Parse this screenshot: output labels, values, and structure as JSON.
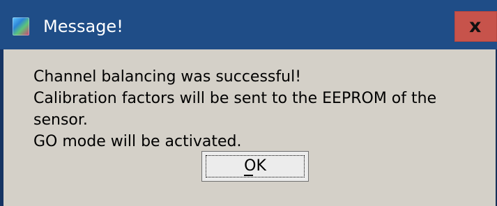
{
  "window": {
    "title": "Message!",
    "close_label": "x"
  },
  "message": {
    "lines": [
      "Channel balancing was successful!",
      "Calibration factors will be sent to the EEPROM of the sensor.",
      "GO mode will be activated."
    ]
  },
  "buttons": {
    "ok_label": "OK"
  },
  "icons": {
    "app_icon": "app-icon",
    "close_icon": "close-icon"
  },
  "colors": {
    "titlebar": "#1f4d87",
    "window_bg": "#d4d0c8",
    "close_button": "#c7534b"
  }
}
